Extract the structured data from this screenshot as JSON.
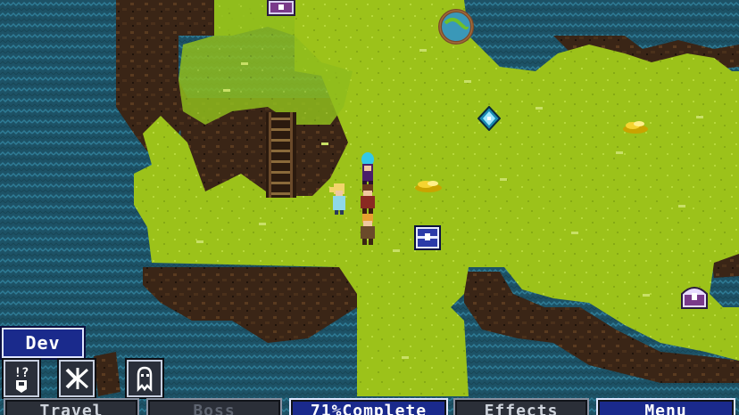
{
  "hud": {
    "character_name": "Dev",
    "icons": [
      "quest-icon",
      "skill-icon",
      "monster-icon"
    ],
    "buttons": {
      "travel": "Travel",
      "boss": "Boss",
      "progress": "71%Complete",
      "effects": "Effects",
      "menu": "Menu"
    }
  },
  "colors": {
    "water": "#1d5266",
    "grass": "#9cc21a",
    "cliff": "#3a2516",
    "hud_panel": "#1a2a8c"
  }
}
